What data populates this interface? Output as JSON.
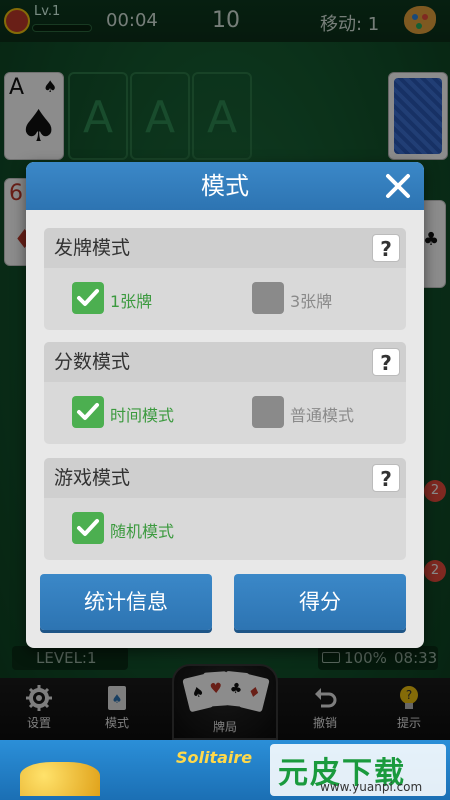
{
  "topbar": {
    "level": "Lv.1",
    "timer": "00:04",
    "score": "10",
    "moves": "移动: 1"
  },
  "board": {
    "foundation_letter": "A",
    "top_card": "A",
    "tableau_card": "6",
    "side_badges": [
      "2",
      "2"
    ]
  },
  "status": {
    "level": "LEVEL:1",
    "battery": "100%",
    "clock": "08:33"
  },
  "toolbar": {
    "settings_label": "设置",
    "mode_label": "模式",
    "deal_label": "牌局",
    "undo_label": "撤销",
    "hint_label": "提示"
  },
  "modal": {
    "title": "模式",
    "sections": [
      {
        "title": "发牌模式",
        "help": "?",
        "options": [
          {
            "label": "1张牌",
            "checked": true
          },
          {
            "label": "3张牌",
            "checked": false
          }
        ]
      },
      {
        "title": "分数模式",
        "help": "?",
        "options": [
          {
            "label": "时间模式",
            "checked": true
          },
          {
            "label": "普通模式",
            "checked": false
          }
        ]
      },
      {
        "title": "游戏模式",
        "help": "?",
        "options": [
          {
            "label": "随机模式",
            "checked": true
          }
        ]
      }
    ],
    "stats_button": "统计信息",
    "score_button": "得分"
  },
  "ad": {
    "brand": "元皮下载",
    "url": "www.yuanpi.com",
    "game_name": "Solitaire"
  },
  "colors": {
    "accent_blue": "#2d74b2",
    "checked_green": "#4caf50",
    "unchecked_gray": "#8a8a8a",
    "felt_green": "#155a30"
  }
}
